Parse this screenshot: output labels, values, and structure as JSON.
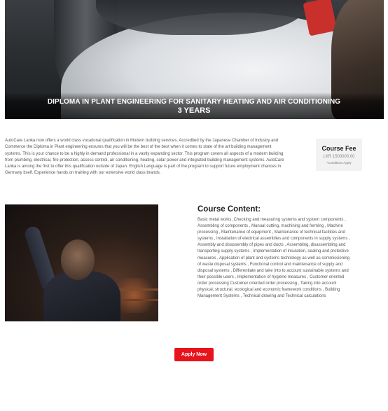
{
  "hero": {
    "title": "DIPLOMA IN PLANT ENGINEERING FOR SANITARY HEATING AND AIR CONDITIONING",
    "subtitle": "3 YEARS"
  },
  "intro": {
    "text": "AutoCare Lanka now offers a world class vocational qualification in Modern building services. Accredited by the Japanese Chamber of Industry and Commerce the Diploma in Plant engineering ensures that you will be the best of the best when it comes to state of the art building management systems. This is your chance to be a highly in demand professional in a vastly expanding sector. This program covers all aspects of a modern building from plumbing, electrical, fire protection, access control, air conditioning, heating, solar power and integrated building management systems. AutoCare Lanka is among the first to offer this qualification outside of Japan. English Language is part of the program to support future employment chances in Germany itself. Experience hands on training with our extensive world class brands."
  },
  "fee": {
    "title": "Course Fee",
    "amount": "LKR 1500000.00",
    "note": "*Conditions Apply"
  },
  "course_content": {
    "title": "Course Content:",
    "text": "Basic metal works ,Checking and measuring systems and system components , Assembling of components , Manual cutting, machining and forming , Machine processing , Maintenance of equipment , Maintenance of technical facilities and systems , Installation of electrical assemblies and components in supply systems , Assembly and disassembly of pipes and ducts , Assembling, disassembling and transporting supply systems , Implementation of insulation, sealing and protective measures , Application of plant and systems technology as well as commissioning of waste disposal systems , Functional control and maintenance of supply and disposal systems , Differentiate and take into to account sustainable systems and their possible users , Implementation of hygiene measures , Customer oriented order processing Customer oriented order processing , Taking into account physical, structural, ecological and economic framework conditions , Building Management Systems , Technical drawing and Technical calculations"
  },
  "actions": {
    "apply_label": "Apply Now"
  }
}
